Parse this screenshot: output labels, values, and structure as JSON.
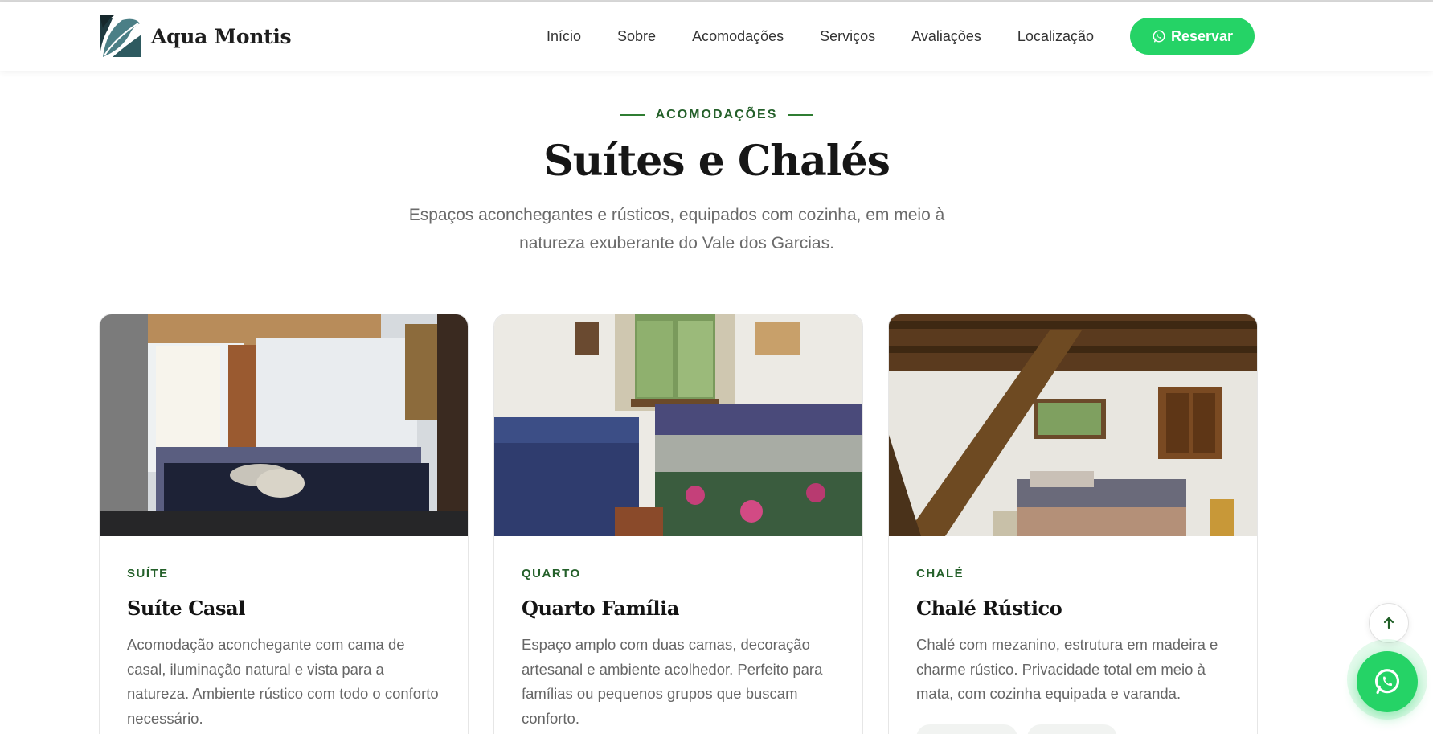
{
  "brand": {
    "name": "Aqua Montis",
    "logo_icon": "leaf-mountain-logo"
  },
  "nav": {
    "items": [
      {
        "label": "Início"
      },
      {
        "label": "Sobre"
      },
      {
        "label": "Acomodações"
      },
      {
        "label": "Serviços"
      },
      {
        "label": "Avaliações"
      },
      {
        "label": "Localização"
      }
    ],
    "cta_label": "Reservar",
    "cta_icon": "whatsapp-icon"
  },
  "section": {
    "eyebrow": "ACOMODAÇÕES",
    "title": "Suítes e Chalés",
    "subtitle": "Espaços aconchegantes e rústicos, equipados com cozinha, em meio à natureza exuberante do Vale dos Garcias."
  },
  "cards": [
    {
      "tag": "SUÍTE",
      "title": "Suíte Casal",
      "description": "Acomodação aconchegante com cama de casal, iluminação natural e vista para a natureza. Ambiente rústico com todo o conforto necessário."
    },
    {
      "tag": "QUARTO",
      "title": "Quarto Família",
      "description": "Espaço amplo com duas camas, decoração artesanal e ambiente acolhedor. Perfeito para famílias ou pequenos grupos que buscam conforto."
    },
    {
      "tag": "CHALÉ",
      "title": "Chalé Rústico",
      "description": "Chalé com mezanino, estrutura em madeira e charme rústico. Privacidade total em meio à mata, com cozinha equipada e varanda."
    }
  ],
  "floating": {
    "back_to_top_icon": "arrow-up-icon",
    "whatsapp_icon": "whatsapp-icon"
  },
  "colors": {
    "accent_green": "#25d366",
    "label_green": "#24602a",
    "logo_teal": "#3d6b70"
  }
}
